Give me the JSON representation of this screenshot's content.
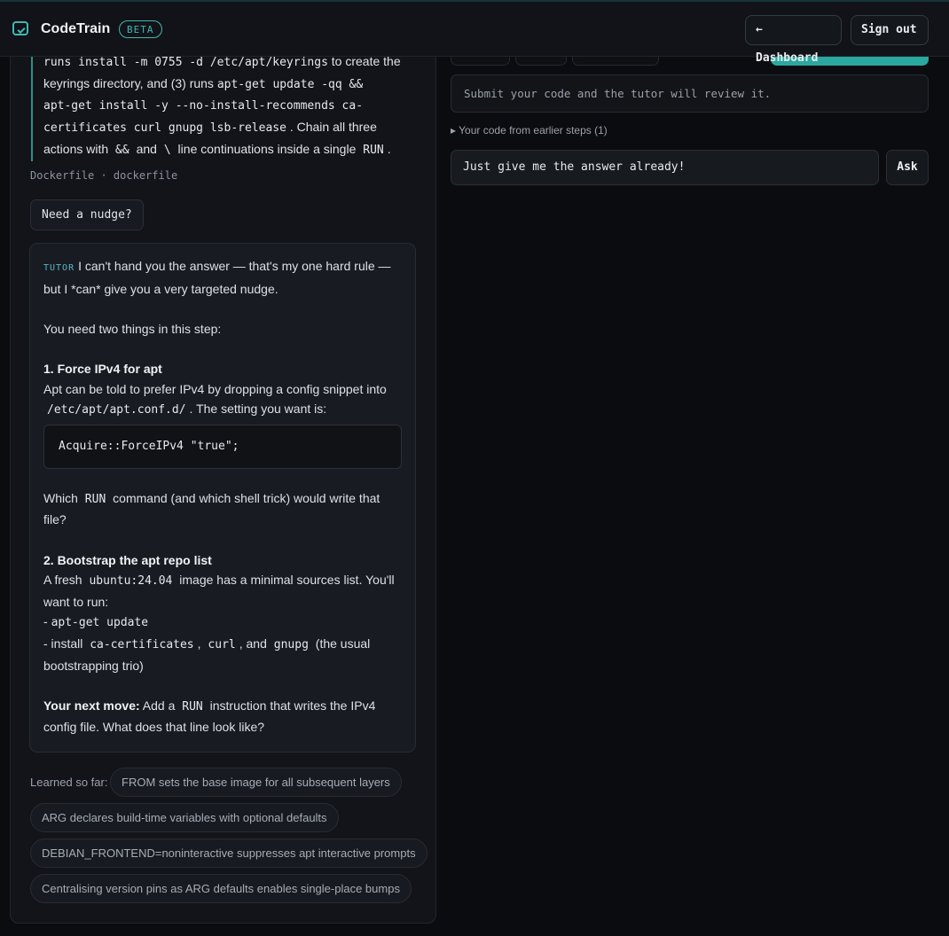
{
  "header": {
    "app_icon": "code-window-icon",
    "title": "CodeTrain",
    "badge": "BETA",
    "dashboard_label": "← Dashboard",
    "signout_label": "Sign out"
  },
  "instructions": {
    "l1_code1": "runs install -m 0755 -d /etc/apt/keyrings",
    "l1_text": " to create the",
    "l2_text": "keyrings directory, and (3) runs ",
    "l2_code": "apt-get update -qq &&",
    "l3_code": "apt-get install -y --no-install-recommends ca-",
    "l4_code": "certificates curl gnupg lsb-release",
    "l4_text": ". Chain all three",
    "l5_text1": "actions with ",
    "l5_code1": "&&",
    "l5_text2": " and ",
    "l5_code2": "\\",
    "l5_text3": " line continuations inside a single ",
    "l5_code3": "RUN",
    "l5_text4": "."
  },
  "file_info": "Dockerfile · dockerfile",
  "nudge_label": "Need a nudge?",
  "tutor": {
    "tag": "TUTOR",
    "intro": "I can't hand you the answer — that's my one hard rule — but I *can* give you a very targeted nudge.",
    "need": "You need two things in this step:",
    "h1": "1. Force IPv4 for apt",
    "p1a": "Apt can be told to prefer IPv4 by dropping a config snippet into",
    "p1_code": "/etc/apt/apt.conf.d/",
    "p1b": ". The setting you want is:",
    "code": "Acquire::ForceIPv4 \"true\";",
    "q_a": "Which ",
    "q_code": "RUN",
    "q_b": " command (and which shell trick) would write that file?",
    "h2": "2. Bootstrap the apt repo list",
    "p2a": "A fresh ",
    "p2_code": "ubuntu:24.04",
    "p2b": " image has a minimal sources list. You'll want to run:",
    "li1_dash": "- ",
    "li1_code": "apt-get update",
    "li2_a": "- install ",
    "li2_c1": "ca-certificates",
    "li2_b": ", ",
    "li2_c2": "curl",
    "li2_c": ", and ",
    "li2_c3": "gnupg",
    "li2_d": " (the usual bootstrapping trio)",
    "next_label": "Your next move:",
    "next_a": " Add a ",
    "next_code": "RUN",
    "next_b": " instruction that writes the IPv4 config file. What does that line look like?"
  },
  "learned": {
    "label": "Learned so far:",
    "chips": [
      "FROM sets the base image for all subsequent layers",
      "ARG declares build-time variables with optional defaults",
      "DEBIAN_FRONTEND=noninteractive suppresses apt interactive prompts",
      "Centralising version pins as ARG defaults enables single-place bumps"
    ]
  },
  "right": {
    "submit_placeholder": "Submit your code and the tutor will review it.",
    "earlier_steps": "▸ Your code from earlier steps (1)",
    "ask_value": "Just give me the answer already!",
    "ask_label": "Ask"
  },
  "colors": {
    "accent": "#3fb8b0",
    "background": "#0b0c0f"
  }
}
